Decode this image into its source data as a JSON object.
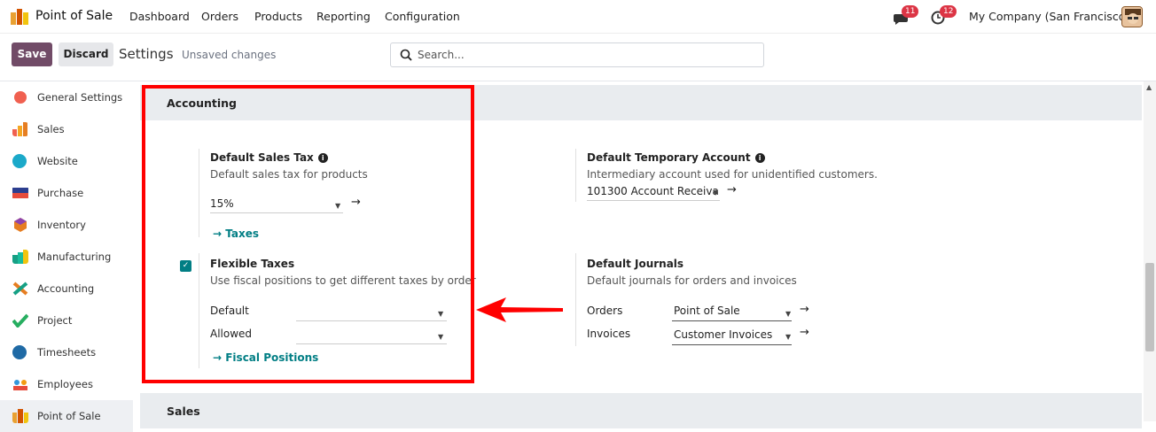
{
  "nav": {
    "app_name": "Point of Sale",
    "menu": [
      "Dashboard",
      "Orders",
      "Products",
      "Reporting",
      "Configuration"
    ],
    "messages_count": "11",
    "activities_count": "12",
    "company": "My Company (San Francisco)"
  },
  "control": {
    "save_label": "Save",
    "discard_label": "Discard",
    "breadcrumb": "Settings",
    "status": "Unsaved changes",
    "search_placeholder": "Search..."
  },
  "sidebar": {
    "items": [
      {
        "label": "General Settings",
        "icon": "general-settings-icon",
        "color": "#f06050"
      },
      {
        "label": "Sales",
        "icon": "sales-icon",
        "color": "#f5a623"
      },
      {
        "label": "Website",
        "icon": "website-icon",
        "color": "#1ba9c9"
      },
      {
        "label": "Purchase",
        "icon": "purchase-icon",
        "color": "#2c3e8f"
      },
      {
        "label": "Inventory",
        "icon": "inventory-icon",
        "color": "#e67e22"
      },
      {
        "label": "Manufacturing",
        "icon": "manufacturing-icon",
        "color": "#16a085"
      },
      {
        "label": "Accounting",
        "icon": "accounting-icon",
        "color": "#e67e22"
      },
      {
        "label": "Project",
        "icon": "project-icon",
        "color": "#27ae60"
      },
      {
        "label": "Timesheets",
        "icon": "timesheets-icon",
        "color": "#1f6aa5"
      },
      {
        "label": "Employees",
        "icon": "employees-icon",
        "color": "#f39c12"
      },
      {
        "label": "Point of Sale",
        "icon": "point-of-sale-icon",
        "color": "#e9a132"
      }
    ]
  },
  "accounting": {
    "title": "Accounting",
    "sales_tax": {
      "title": "Default Sales Tax",
      "desc": "Default sales tax for products",
      "value": "15%",
      "link": "Taxes"
    },
    "temp_account": {
      "title": "Default Temporary Account",
      "desc": "Intermediary account used for unidentified customers.",
      "value": "101300 Account Receiva"
    },
    "flexible_taxes": {
      "title": "Flexible Taxes",
      "desc": "Use fiscal positions to get different taxes by order",
      "checked": true,
      "default_label": "Default",
      "allowed_label": "Allowed",
      "link": "Fiscal Positions"
    },
    "journals": {
      "title": "Default Journals",
      "desc": "Default journals for orders and invoices",
      "orders_label": "Orders",
      "orders_value": "Point of Sale",
      "invoices_label": "Invoices",
      "invoices_value": "Customer Invoices"
    }
  },
  "sales_section": {
    "title": "Sales"
  },
  "colors": {
    "brand": "#714B67",
    "accent": "#017e84",
    "annotation": "#ff0000",
    "badge": "#dc3545"
  }
}
